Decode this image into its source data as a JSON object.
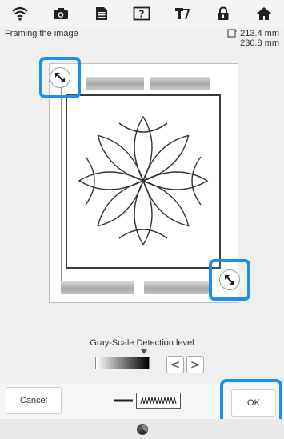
{
  "toolbar": {
    "icons": [
      "wifi-icon",
      "camera-icon",
      "document-icon",
      "help-icon",
      "thread-icon",
      "lock-icon",
      "home-icon"
    ],
    "help_glyph": "?"
  },
  "header": {
    "title": "Framing the image",
    "size_width": "213.4 mm",
    "size_height": "230.8 mm"
  },
  "detection": {
    "label": "Gray-Scale Detection level",
    "prev_glyph": "<",
    "next_glyph": ">"
  },
  "actions": {
    "cancel_label": "Cancel",
    "ok_label": "OK"
  },
  "colors": {
    "highlight": "#1f8ef1"
  }
}
